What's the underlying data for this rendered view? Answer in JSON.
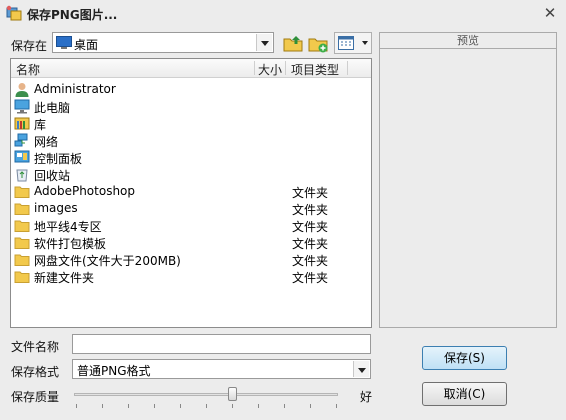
{
  "window": {
    "title": "保存PNG图片..."
  },
  "save_in": {
    "label": "保存在",
    "value": "桌面"
  },
  "list": {
    "headers": {
      "name": "名称",
      "size": "大小",
      "type": "项目类型"
    },
    "items": [
      {
        "icon": "user-icon",
        "name": "Administrator",
        "type": ""
      },
      {
        "icon": "computer-icon",
        "name": "此电脑",
        "type": ""
      },
      {
        "icon": "library-icon",
        "name": "库",
        "type": ""
      },
      {
        "icon": "network-icon",
        "name": "网络",
        "type": ""
      },
      {
        "icon": "control-panel-icon",
        "name": "控制面板",
        "type": ""
      },
      {
        "icon": "recycle-bin-icon",
        "name": "回收站",
        "type": ""
      },
      {
        "icon": "folder-icon",
        "name": "AdobePhotoshop",
        "type": "文件夹"
      },
      {
        "icon": "folder-icon",
        "name": "images",
        "type": "文件夹"
      },
      {
        "icon": "folder-icon",
        "name": "地平线4专区",
        "type": "文件夹"
      },
      {
        "icon": "folder-icon",
        "name": "软件打包模板",
        "type": "文件夹"
      },
      {
        "icon": "folder-icon",
        "name": "网盘文件(文件大于200MB)",
        "type": "文件夹"
      },
      {
        "icon": "folder-icon",
        "name": "新建文件夹",
        "type": "文件夹"
      }
    ]
  },
  "preview": {
    "label": "预览"
  },
  "filename": {
    "label": "文件名称",
    "value": ""
  },
  "format": {
    "label": "保存格式",
    "value": "普通PNG格式"
  },
  "quality": {
    "label": "保存质量",
    "end_label": "好",
    "level": 0.6
  },
  "buttons": {
    "save": "保存(S)",
    "cancel": "取消(C)"
  },
  "colors": {
    "folder": "#f2c94c",
    "accent": "#3c7fb1",
    "desktop": "#2a6fc7"
  }
}
